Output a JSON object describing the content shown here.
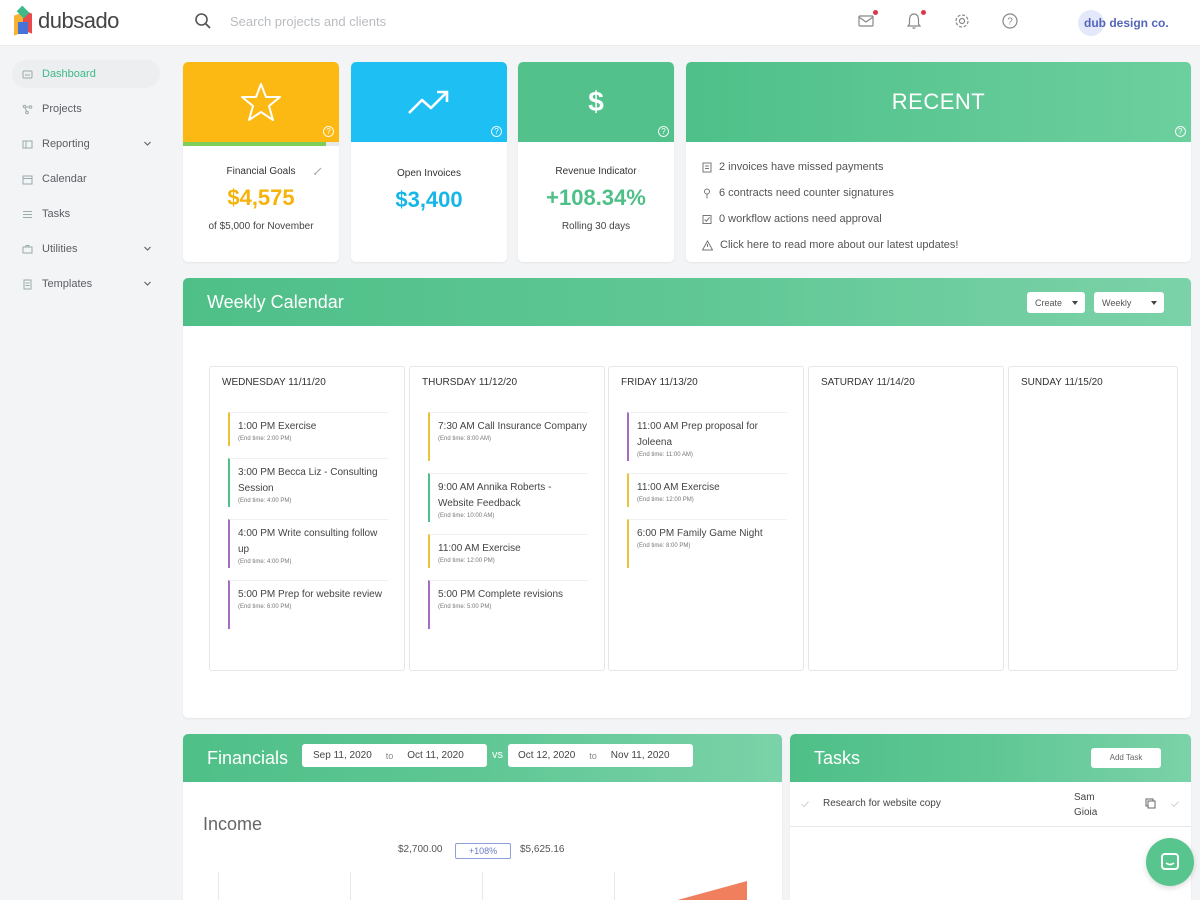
{
  "app": {
    "logo": "dubsado",
    "brand": "dub design co."
  },
  "search": {
    "placeholder": "Search projects and clients"
  },
  "sidebar": {
    "items": [
      {
        "label": "Dashboard",
        "icon": "dashboard-icon",
        "active": true
      },
      {
        "label": "Projects",
        "icon": "projects-icon"
      },
      {
        "label": "Reporting",
        "icon": "reporting-icon",
        "expandable": true
      },
      {
        "label": "Calendar",
        "icon": "calendar-icon"
      },
      {
        "label": "Tasks",
        "icon": "tasks-icon"
      },
      {
        "label": "Utilities",
        "icon": "utilities-icon",
        "expandable": true
      },
      {
        "label": "Templates",
        "icon": "templates-icon",
        "expandable": true
      }
    ]
  },
  "stats": {
    "goals": {
      "label": "Financial Goals",
      "value": "$4,575",
      "sub": "of $5,000 for November",
      "color": "#f6b30d",
      "progress": 0.915
    },
    "invoices": {
      "label": "Open Invoices",
      "value": "$3,400",
      "color": "#17b6e8"
    },
    "revenue": {
      "label": "Revenue Indicator",
      "value": "+108.34%",
      "sub": "Rolling 30 days",
      "color": "#4fbf88"
    }
  },
  "recent": {
    "title": "RECENT",
    "items": [
      "2 invoices have missed payments",
      "6 contracts need counter signatures",
      "0 workflow actions need approval",
      "Click here to read more about our latest updates!"
    ]
  },
  "calendar": {
    "title": "Weekly Calendar",
    "create_label": "Create",
    "view_label": "Weekly",
    "days": [
      {
        "title": "WEDNESDAY 11/11/20",
        "events": [
          {
            "title": "1:00 PM  Exercise",
            "end": "(End time: 2:00 PM)",
            "color": "#e9c43a"
          },
          {
            "title": "3:00 PM  Becca Liz - Consulting Session",
            "end": "(End time: 4:00 PM)",
            "color": "#4fbf88"
          },
          {
            "title": "4:00 PM  Write consulting follow up",
            "end": "(End time: 4:00 PM)",
            "color": "#a66bc2"
          },
          {
            "title": "5:00 PM  Prep for website review",
            "end": "(End time: 6:00 PM)",
            "color": "#a66bc2"
          }
        ]
      },
      {
        "title": "THURSDAY 11/12/20",
        "events": [
          {
            "title": "7:30 AM  Call Insurance Company",
            "end": "(End time: 8:00 AM)",
            "color": "#e9c43a"
          },
          {
            "title": "9:00 AM  Annika Roberts - Website Feedback",
            "end": "(End time: 10:00 AM)",
            "color": "#4fbf88"
          },
          {
            "title": "11:00 AM  Exercise",
            "end": "(End time: 12:00 PM)",
            "color": "#e9c43a"
          },
          {
            "title": "5:00 PM  Complete revisions",
            "end": "(End time: 5:00 PM)",
            "color": "#a66bc2"
          }
        ]
      },
      {
        "title": "FRIDAY 11/13/20",
        "events": [
          {
            "title": "11:00 AM  Prep proposal for Joleena",
            "end": "(End time: 11:00 AM)",
            "color": "#a66bc2"
          },
          {
            "title": "11:00 AM  Exercise",
            "end": "(End time: 12:00 PM)",
            "color": "#e9c43a"
          },
          {
            "title": "6:00 PM  Family Game Night",
            "end": "(End time: 8:00 PM)",
            "color": "#e9c43a"
          }
        ]
      },
      {
        "title": "SATURDAY 11/14/20",
        "events": []
      },
      {
        "title": "SUNDAY 11/15/20",
        "events": []
      }
    ]
  },
  "financials": {
    "title": "Financials",
    "range_a": {
      "from": "Sep 11, 2020",
      "to_label": "to",
      "to": "Oct 11, 2020"
    },
    "vs_label": "vs",
    "range_b": {
      "from": "Oct 12, 2020",
      "to_label": "to",
      "to": "Nov 11, 2020"
    },
    "income_title": "Income",
    "prev_value": "$2,700.00",
    "change": "+108%",
    "curr_value": "$5,625.16"
  },
  "tasks": {
    "title": "Tasks",
    "add_label": "Add Task",
    "rows": [
      {
        "name": "Research for website copy",
        "assignee": "Sam Gioia"
      }
    ]
  },
  "colors": {
    "accent": "#4fbf88",
    "goals": "#fdb913",
    "invoices": "#1ebff2",
    "revenue": "#52c18b"
  }
}
